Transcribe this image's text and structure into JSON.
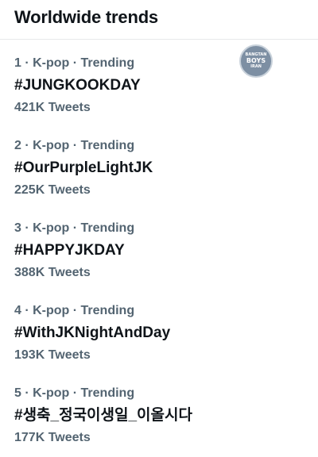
{
  "header": {
    "title": "Worldwide trends"
  },
  "watermark": {
    "line1": "BANGTAN",
    "line2": "BOYS",
    "line3": "IRAN"
  },
  "trends": [
    {
      "meta": "1 · K-pop · Trending",
      "name": "#JUNGKOOKDAY",
      "count": "421K Tweets"
    },
    {
      "meta": "2 · K-pop · Trending",
      "name": "#OurPurpleLightJK",
      "count": "225K Tweets"
    },
    {
      "meta": "3 · K-pop · Trending",
      "name": "#HAPPYJKDAY",
      "count": "388K Tweets"
    },
    {
      "meta": "4 · K-pop · Trending",
      "name": "#WithJKNightAndDay",
      "count": "193K Tweets"
    },
    {
      "meta": "5 · K-pop · Trending",
      "name": "#생축_정국이생일_이올시다",
      "count": "177K Tweets"
    }
  ],
  "colors": {
    "primary_text": "#0f1419",
    "secondary_text": "#536471",
    "divider": "#e7e9ea"
  }
}
